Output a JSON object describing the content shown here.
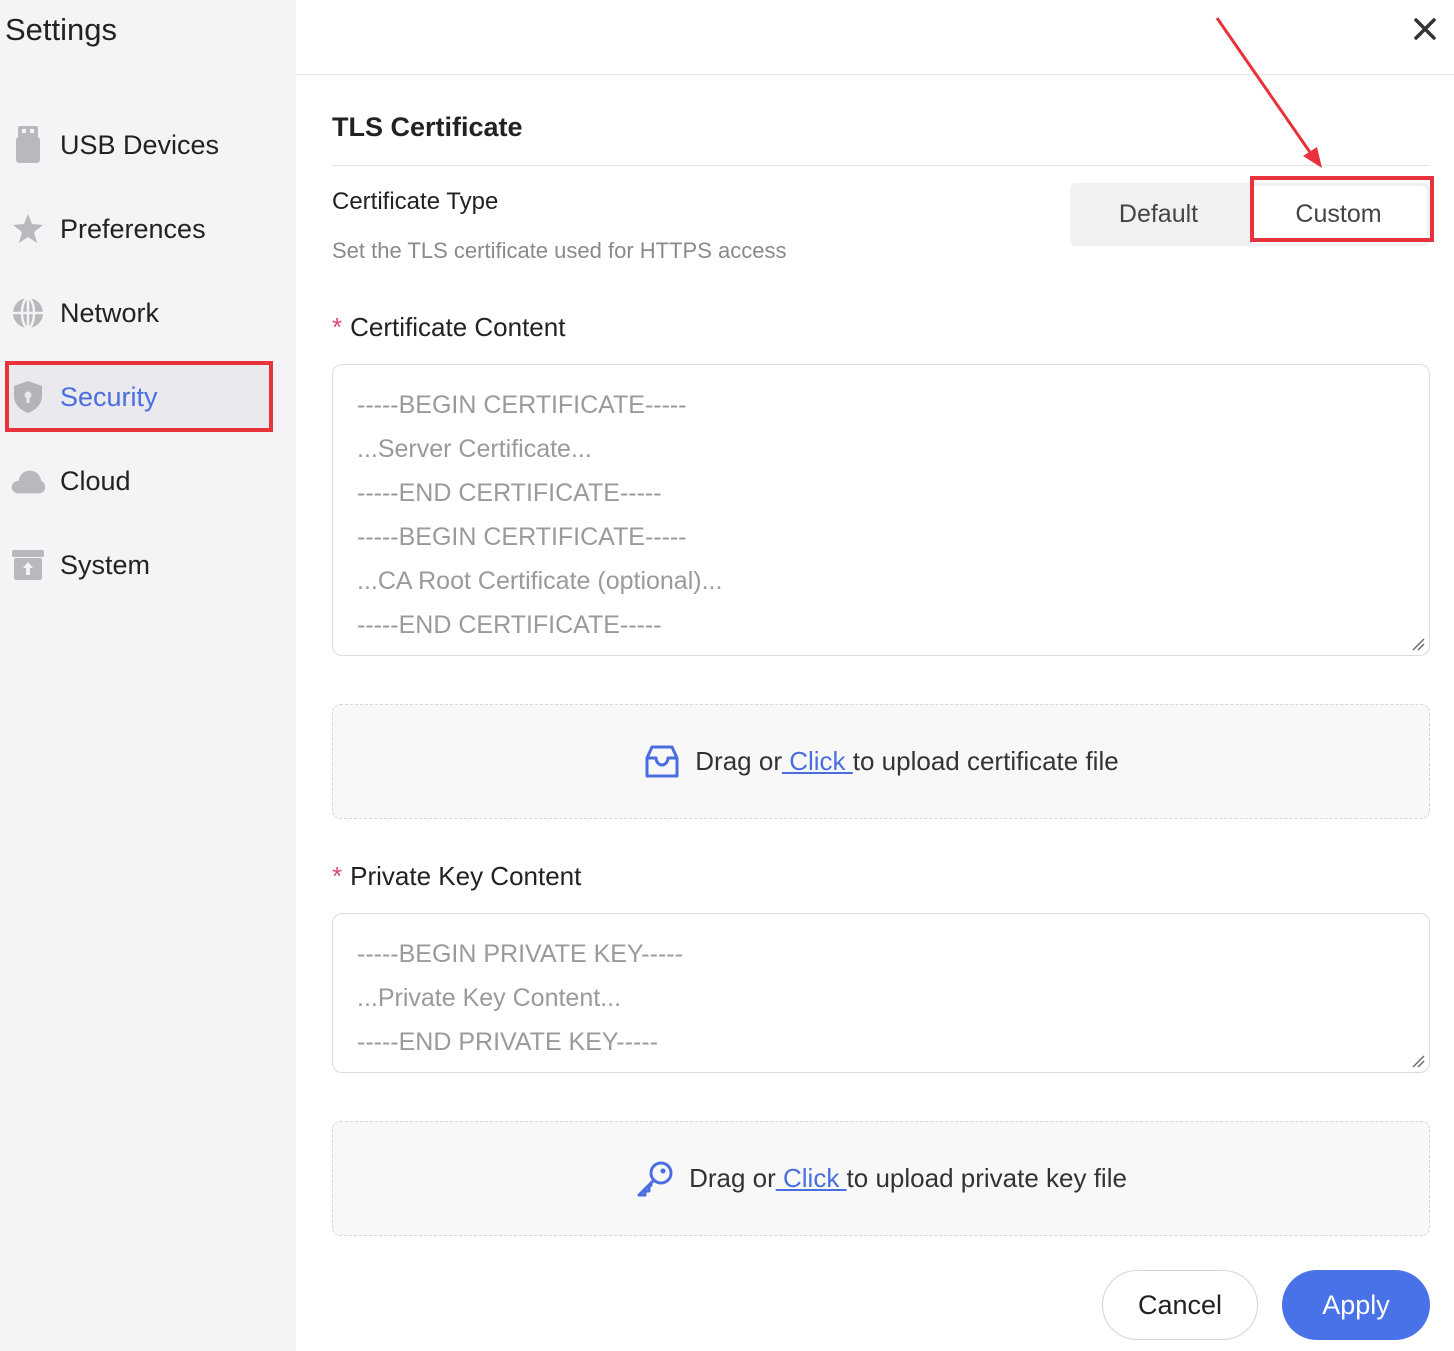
{
  "sidebar": {
    "title": "Settings",
    "items": [
      {
        "label": "USB Devices",
        "icon": "usb-icon"
      },
      {
        "label": "Preferences",
        "icon": "star-icon"
      },
      {
        "label": "Network",
        "icon": "globe-icon"
      },
      {
        "label": "Security",
        "icon": "shield-icon",
        "active": true
      },
      {
        "label": "Cloud",
        "icon": "cloud-icon"
      },
      {
        "label": "System",
        "icon": "system-icon"
      }
    ]
  },
  "colors": {
    "accent": "#4a6ee0",
    "highlight": "#e8323c",
    "required": "#e0457b",
    "apply": "#4a72e8"
  },
  "main": {
    "section_title": "TLS Certificate",
    "cert_type": {
      "label": "Certificate Type",
      "description": "Set the TLS certificate used for HTTPS access",
      "options": [
        "Default",
        "Custom"
      ],
      "selected": "Custom"
    },
    "cert_content": {
      "label": "Certificate Content",
      "placeholder_lines": [
        "-----BEGIN CERTIFICATE-----",
        "...Server Certificate...",
        "-----END CERTIFICATE-----",
        "-----BEGIN CERTIFICATE-----",
        "...CA Root Certificate (optional)...",
        "-----END CERTIFICATE-----"
      ]
    },
    "cert_upload": {
      "prefix": "Drag or",
      "link": " Click ",
      "suffix": "to upload certificate file",
      "icon": "inbox-icon"
    },
    "key_content": {
      "label": "Private Key Content",
      "placeholder_lines": [
        "-----BEGIN PRIVATE KEY-----",
        "...Private Key Content...",
        "-----END PRIVATE KEY-----"
      ]
    },
    "key_upload": {
      "prefix": "Drag or",
      "link": " Click ",
      "suffix": "to upload private key file",
      "icon": "key-icon"
    },
    "buttons": {
      "cancel": "Cancel",
      "apply": "Apply"
    }
  }
}
